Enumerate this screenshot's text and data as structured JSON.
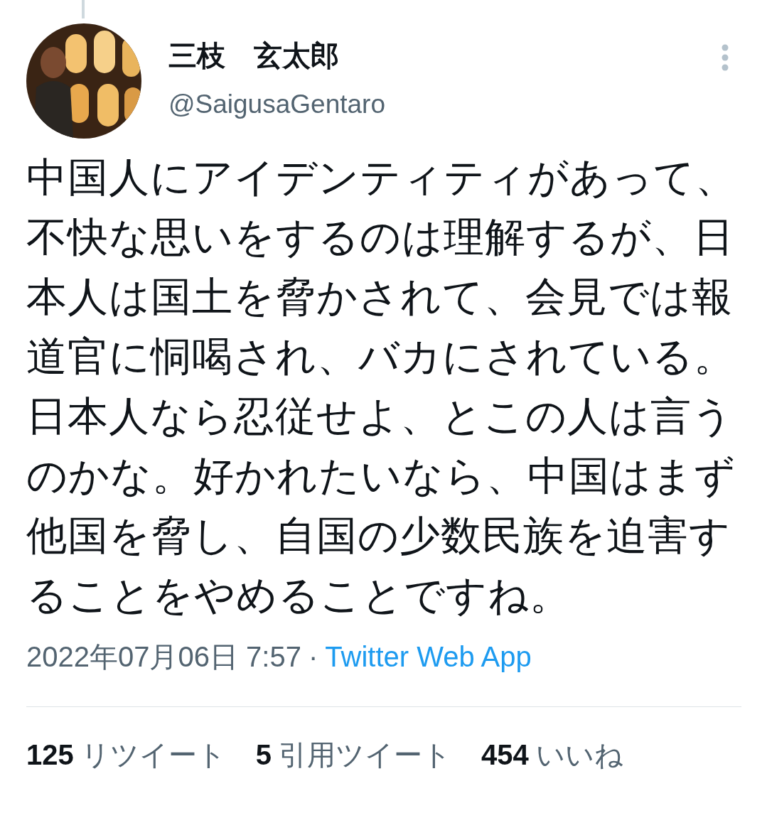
{
  "author": {
    "name": "三枝　玄太郎",
    "handle": "@SaigusaGentaro"
  },
  "tweet": {
    "text": "中国人にアイデンティティがあって、不快な思いをするのは理解するが、日本人は国土を脅かされて、会見では報道官に恫喝され、バカにされている。日本人なら忍従せよ、とこの人は言うのかな。好かれたいなら、中国はまず他国を脅し、自国の少数民族を迫害することをやめることですね。"
  },
  "meta": {
    "timestamp": "2022年07月06日 7:57",
    "separator": "·",
    "source": "Twitter Web App"
  },
  "stats": [
    {
      "count": "125",
      "label": "リツイート"
    },
    {
      "count": "5",
      "label": "引用ツイート"
    },
    {
      "count": "454",
      "label": "いいね"
    }
  ]
}
